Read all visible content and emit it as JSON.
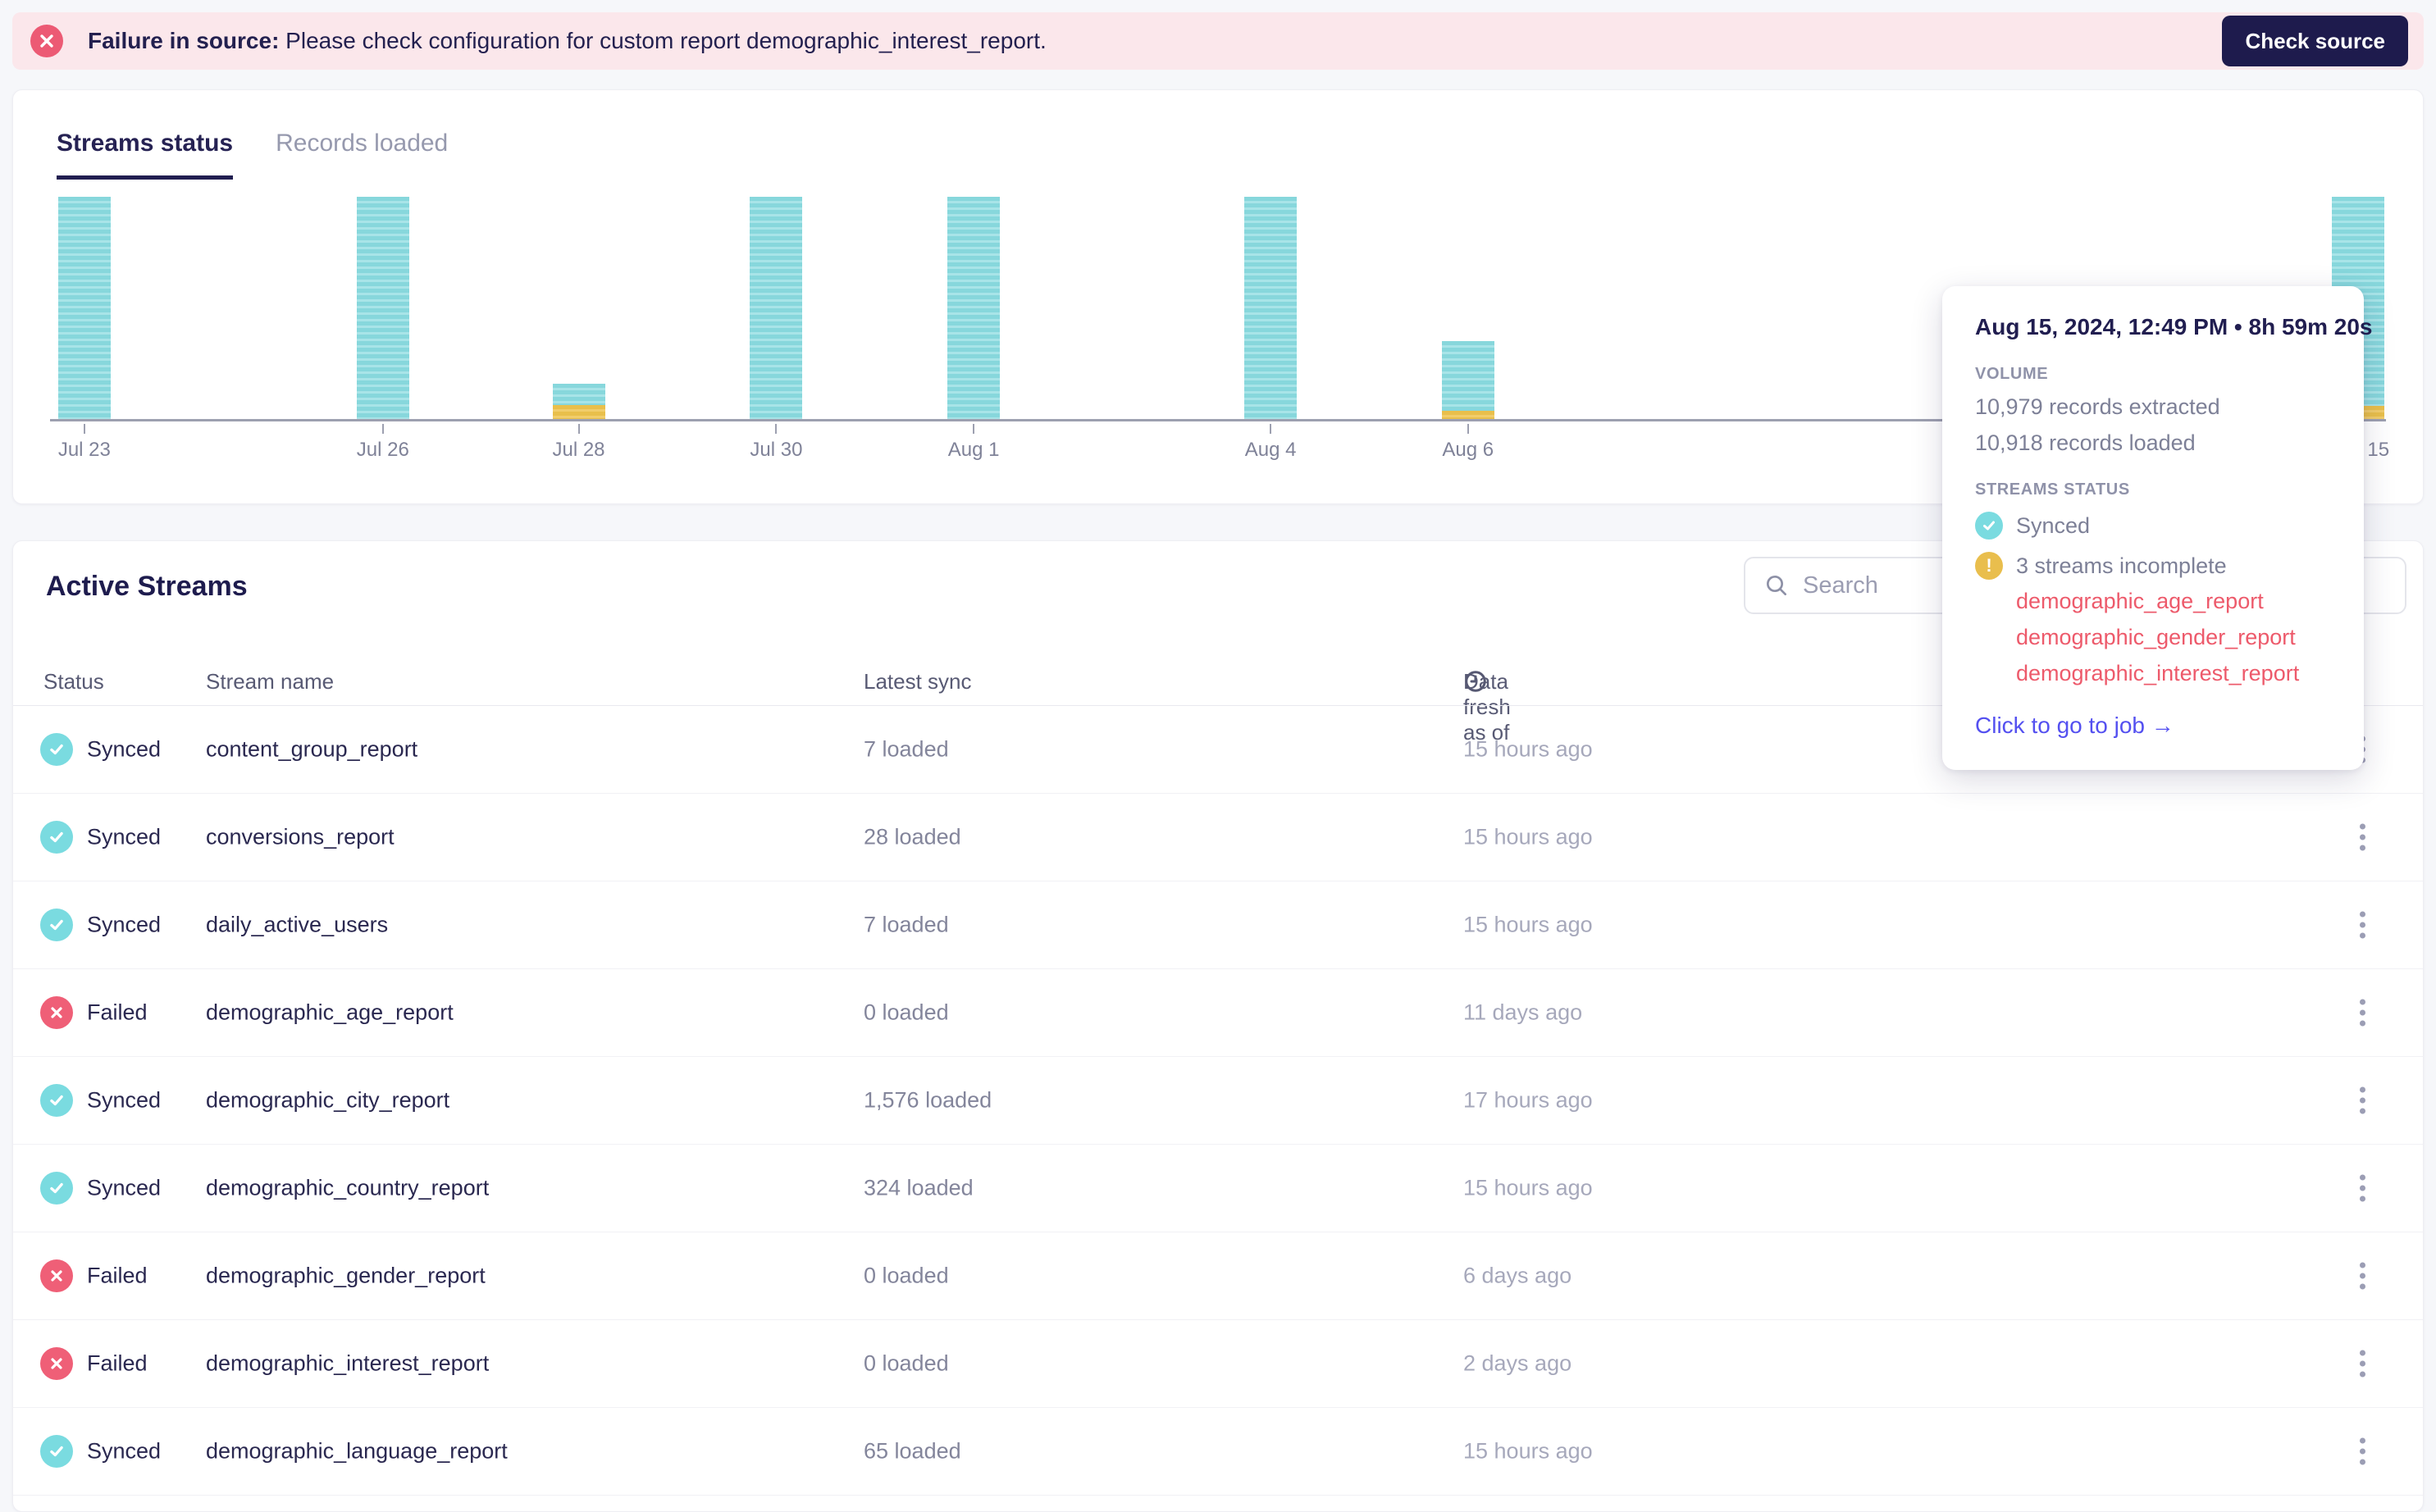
{
  "banner": {
    "message_bold": "Failure in source:",
    "message_rest": " Please check configuration for custom report demographic_interest_report.",
    "button_label": "Check source"
  },
  "colors": {
    "banner_bg": "#FBE7EB",
    "error_red": "#EC5A74",
    "navy": "#1E1B4D",
    "teal": "#87D7DC",
    "yellow": "#E9BF4B",
    "failed_red": "#EF5F77",
    "synced_teal": "#7ADBE0",
    "link_blue": "#5450F0",
    "incomplete_red": "#ED5A6B"
  },
  "chart_card": {
    "tabs": [
      {
        "label": "Streams status",
        "active": true
      },
      {
        "label": "Records loaded",
        "active": false
      }
    ],
    "chart_data": {
      "type": "bar",
      "stacked": true,
      "x": [
        "Jul 23",
        "Jul 26",
        "Jul 28",
        "Jul 30",
        "Aug 1",
        "Aug 4",
        "Aug 6",
        "Aug 15"
      ],
      "series": [
        {
          "name": "synced",
          "color": "#87D7DC",
          "values_pct": [
            100,
            100,
            9.6,
            100,
            100,
            100,
            31.4,
            94.1
          ]
        },
        {
          "name": "incomplete",
          "color": "#E9BF4B",
          "values_pct": [
            0,
            0,
            6.3,
            0,
            0,
            0,
            3.7,
            5.9
          ]
        }
      ],
      "bars": [
        {
          "date": "Jul 23",
          "center_pct": 1.47,
          "synced_pct": 100,
          "incomplete_pct": 0
        },
        {
          "date": "Jul 26",
          "center_pct": 14.25,
          "synced_pct": 100,
          "incomplete_pct": 0
        },
        {
          "date": "Jul 28",
          "center_pct": 22.63,
          "synced_pct": 9.6,
          "incomplete_pct": 6.3
        },
        {
          "date": "Jul 30",
          "center_pct": 31.09,
          "synced_pct": 100,
          "incomplete_pct": 0
        },
        {
          "date": "Aug 1",
          "center_pct": 39.54,
          "synced_pct": 100,
          "incomplete_pct": 0
        },
        {
          "date": "Aug 4",
          "center_pct": 52.25,
          "synced_pct": 100,
          "incomplete_pct": 0
        },
        {
          "date": "Aug 6",
          "center_pct": 60.7,
          "synced_pct": 31.4,
          "incomplete_pct": 3.7
        },
        {
          "date": "Aug 15",
          "center_pct": 98.81,
          "synced_pct": 94.1,
          "incomplete_pct": 5.9
        }
      ],
      "ylim_pct": [
        0,
        100
      ],
      "grid": false,
      "legend": false
    }
  },
  "tooltip": {
    "title": "Aug 15, 2024, 12:49 PM • 8h 59m 20s",
    "volume_label": "VOLUME",
    "extracted": "10,979 records extracted",
    "loaded": "10,918 records loaded",
    "streams_status_label": "STREAMS STATUS",
    "synced_label": "Synced",
    "incomplete_label": "3 streams incomplete",
    "incomplete_streams": [
      "demographic_age_report",
      "demographic_gender_report",
      "demographic_interest_report"
    ],
    "link_label": "Click to go to job →"
  },
  "active_streams": {
    "title": "Active Streams",
    "search_placeholder": "Search",
    "columns": [
      "Status",
      "Stream name",
      "Latest sync",
      "Data fresh as of"
    ],
    "rows": [
      {
        "status": "Synced",
        "status_type": "synced",
        "stream": "content_group_report",
        "loaded": "7 loaded",
        "fresh": "15 hours ago"
      },
      {
        "status": "Synced",
        "status_type": "synced",
        "stream": "conversions_report",
        "loaded": "28 loaded",
        "fresh": "15 hours ago"
      },
      {
        "status": "Synced",
        "status_type": "synced",
        "stream": "daily_active_users",
        "loaded": "7 loaded",
        "fresh": "15 hours ago"
      },
      {
        "status": "Failed",
        "status_type": "failed",
        "stream": "demographic_age_report",
        "loaded": "0 loaded",
        "fresh": "11 days ago"
      },
      {
        "status": "Synced",
        "status_type": "synced",
        "stream": "demographic_city_report",
        "loaded": "1,576 loaded",
        "fresh": "17 hours ago"
      },
      {
        "status": "Synced",
        "status_type": "synced",
        "stream": "demographic_country_report",
        "loaded": "324 loaded",
        "fresh": "15 hours ago"
      },
      {
        "status": "Failed",
        "status_type": "failed",
        "stream": "demographic_gender_report",
        "loaded": "0 loaded",
        "fresh": "6 days ago"
      },
      {
        "status": "Failed",
        "status_type": "failed",
        "stream": "demographic_interest_report",
        "loaded": "0 loaded",
        "fresh": "2 days ago"
      },
      {
        "status": "Synced",
        "status_type": "synced",
        "stream": "demographic_language_report",
        "loaded": "65 loaded",
        "fresh": "15 hours ago"
      }
    ]
  }
}
